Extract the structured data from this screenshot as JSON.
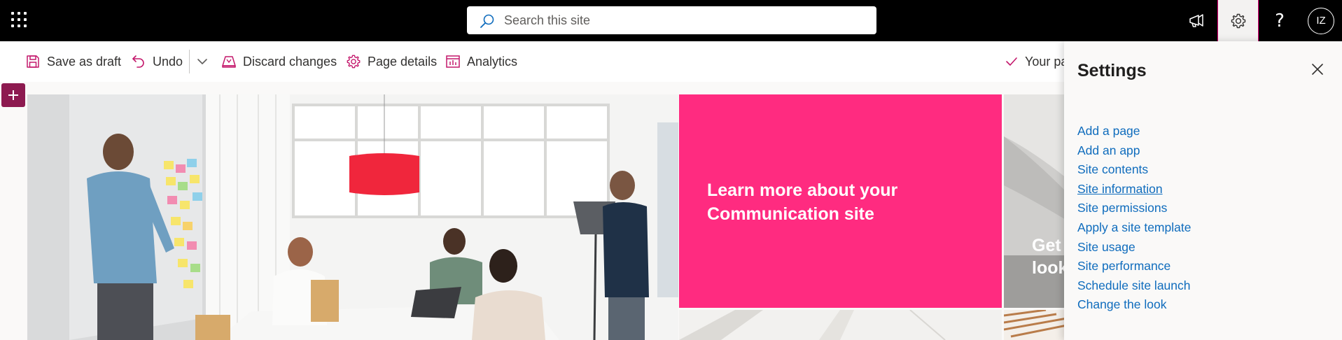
{
  "suite": {
    "search_placeholder": "Search this site",
    "user_initials": "IZ",
    "icons": [
      "app-launcher-icon",
      "search-icon",
      "megaphone-icon",
      "gear-icon",
      "help-icon"
    ]
  },
  "toolbar": {
    "save_label": "Save as draft",
    "undo_label": "Undo",
    "discard_label": "Discard changes",
    "page_details_label": "Page details",
    "analytics_label": "Analytics",
    "status_text": "Your pa"
  },
  "hero": {
    "tile1_text": "Learn more about your Communication site",
    "tile2_text": "Get\nlook"
  },
  "settings": {
    "title": "Settings",
    "links": [
      "Add a page",
      "Add an app",
      "Site contents",
      "Site information",
      "Site permissions",
      "Apply a site template",
      "Site usage",
      "Site performance",
      "Schedule site launch",
      "Change the look"
    ]
  },
  "colors": {
    "accent": "#e3007b",
    "tile_pink": "#ff2b80",
    "link": "#0f6cbd",
    "add_button": "#8d1a50"
  }
}
